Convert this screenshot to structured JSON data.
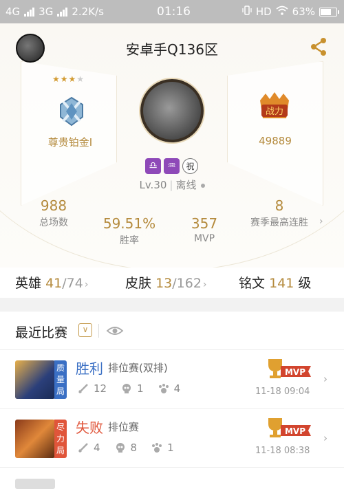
{
  "status_bar": {
    "network1": "4G",
    "network2": "3G",
    "speed": "2.2K/s",
    "time": "01:16",
    "hd": "HD",
    "battery": "63%",
    "battery_level": 0.63
  },
  "header": {
    "title": "安卓手Q136区"
  },
  "rank": {
    "stars": "★★★",
    "empty_star": "★",
    "name": "尊贵铂金I"
  },
  "power": {
    "value": "49889"
  },
  "badges": [
    "♎",
    "♒",
    "祝"
  ],
  "level": {
    "text": "Lv.30",
    "separator": "|",
    "status": "离线"
  },
  "stats": {
    "total_value": "988",
    "total_label": "总场数",
    "winrate_value": "59.51%",
    "winrate_label": "胜率",
    "mvp_value": "357",
    "mvp_label": "MVP",
    "streak_value": "8",
    "streak_label": "赛季最高连胜"
  },
  "collection": {
    "hero_label": "英雄",
    "hero_owned": "41",
    "hero_total": "/74",
    "skin_label": "皮肤",
    "skin_owned": "13",
    "skin_total": "/162",
    "rune_label": "铭文",
    "rune_value": "141",
    "rune_unit": "级"
  },
  "recent": {
    "title": "最近比赛",
    "dropdown": "∨",
    "matches": [
      {
        "tag": "质量局",
        "tag_color": "#3a6fc4",
        "result": "胜利",
        "result_color": "#3a6fc4",
        "mode": "排位赛(双排)",
        "kills": "12",
        "deaths": "1",
        "assists": "4",
        "time": "11-18 09:04",
        "mvp": "MVP"
      },
      {
        "tag": "尽力局",
        "tag_color": "#e0553a",
        "result": "失败",
        "result_color": "#e0553a",
        "mode": "排位赛",
        "kills": "4",
        "deaths": "8",
        "assists": "1",
        "time": "11-18 08:38",
        "mvp": "MVP"
      }
    ]
  },
  "colors": {
    "gold": "#b48a3c",
    "badge_purple": "#8e49b8"
  }
}
